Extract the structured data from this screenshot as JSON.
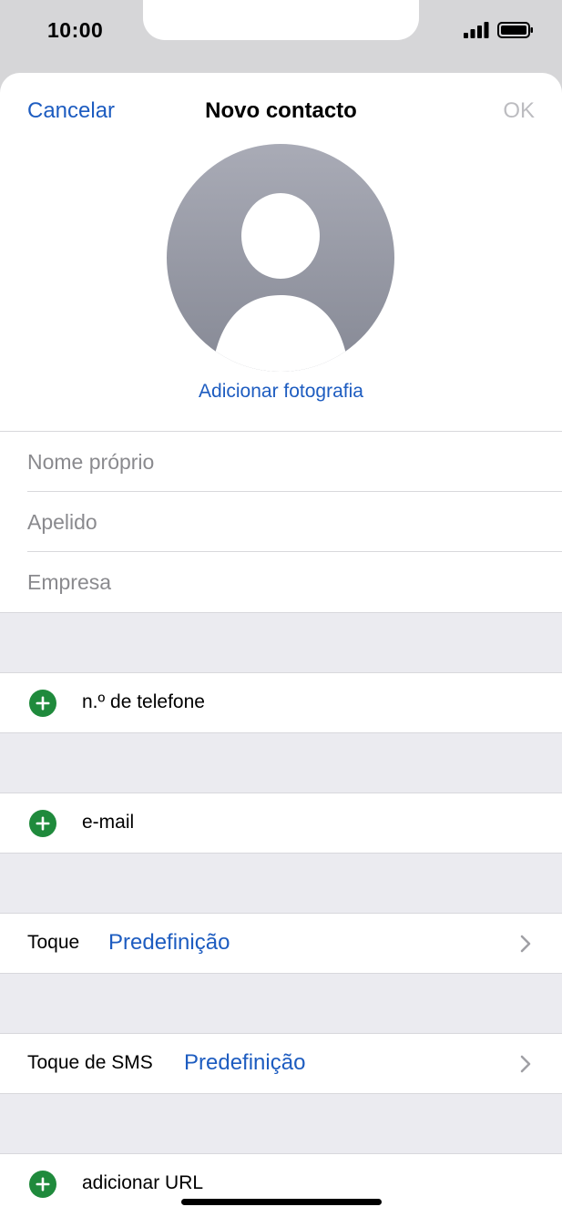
{
  "status_bar": {
    "time": "10:00"
  },
  "nav": {
    "cancel_label": "Cancelar",
    "title": "Novo contacto",
    "ok_label": "OK"
  },
  "photo": {
    "add_label": "Adicionar fotografia"
  },
  "name_fields": {
    "first_name_placeholder": "Nome próprio",
    "last_name_placeholder": "Apelido",
    "company_placeholder": "Empresa"
  },
  "add_rows": {
    "phone_label": "n.º de telefone",
    "email_label": "e-mail",
    "url_label": "adicionar URL"
  },
  "ringtone": {
    "label": "Toque",
    "value": "Predefinição"
  },
  "text_tone": {
    "label": "Toque de SMS",
    "value": "Predefinição"
  },
  "colors": {
    "accent": "#1d5cc0",
    "add_green": "#1f8a3c",
    "placeholder": "#8a8a8e",
    "disabled": "#bcbcc0",
    "section_gap": "#ebebf0"
  }
}
